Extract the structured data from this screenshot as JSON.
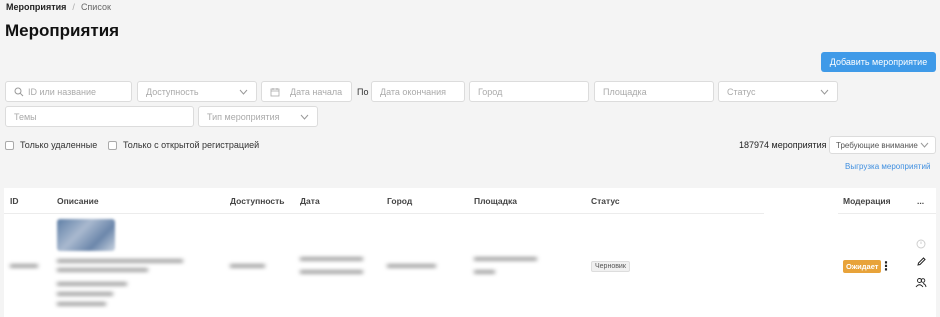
{
  "breadcrumb": {
    "root": "Мероприятия",
    "sep": "/",
    "current": "Список"
  },
  "page_title": "Мероприятия",
  "add_button": "Добавить мероприятие",
  "filters": {
    "search_placeholder": "ID или название",
    "availability": "Доступность",
    "date_start": "Дата начала",
    "po": "По",
    "date_end": "Дата окончания",
    "city": "Город",
    "venue": "Площадка",
    "status": "Статус",
    "topics": "Темы",
    "event_type": "Тип мероприятия"
  },
  "checkboxes": {
    "deleted_only": "Только удаленные",
    "open_registration": "Только с открытой регистрацией"
  },
  "count_text": "187974 мероприятия",
  "sort_select": "Требующие внимание",
  "export_link": "Выгрузка мероприятий",
  "table": {
    "headers": {
      "id": "ID",
      "description": "Описание",
      "availability": "Доступность",
      "date": "Дата",
      "city": "Город",
      "venue": "Площадка",
      "status": "Статус",
      "moderation": "Модерация",
      "more": "..."
    },
    "row": {
      "status": "Черновик",
      "moderation": "Ожидает",
      "kebab": "⋮"
    }
  },
  "colors": {
    "accent": "#3f9ae8",
    "moderation_badge": "#e8a33a",
    "link": "#3f8fe0"
  },
  "icons": [
    "search-icon",
    "chevron-down-icon",
    "calendar-icon",
    "clock-icon",
    "pencil-icon",
    "users-icon"
  ]
}
